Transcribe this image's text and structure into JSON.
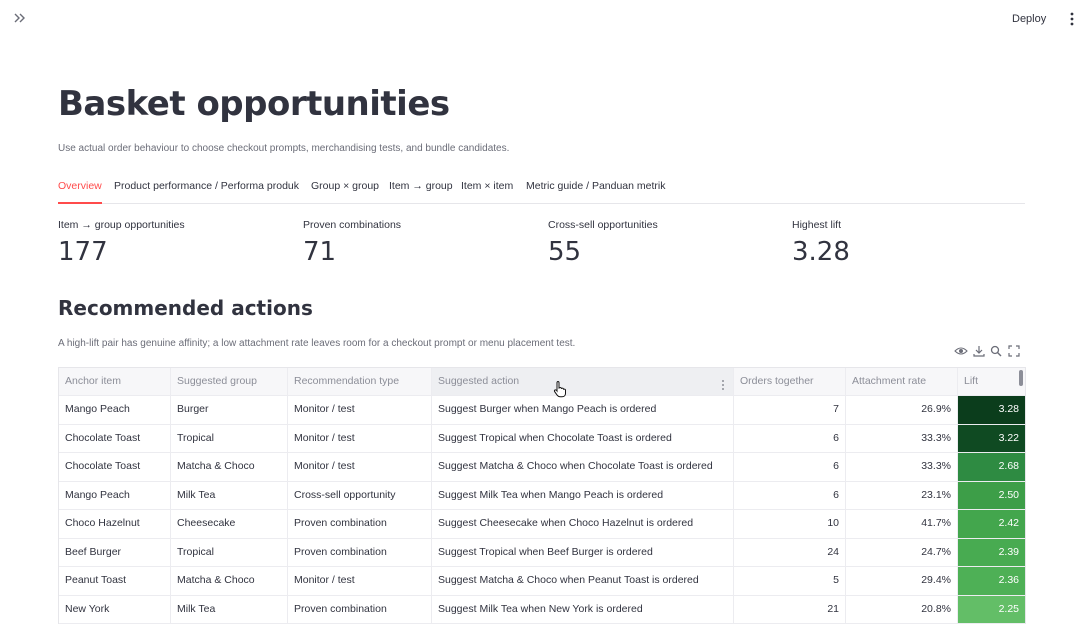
{
  "topbar": {
    "deploy_label": "Deploy",
    "expand_icon": "double-chevron-right-icon",
    "menu_icon": "kebab-menu-icon"
  },
  "page": {
    "title": "Basket opportunities",
    "caption": "Use actual order behaviour to choose checkout prompts, merchandising tests, and bundle candidates."
  },
  "tabs": [
    {
      "label": "Overview",
      "active": true
    },
    {
      "label": "Product performance / Performa produk",
      "active": false
    },
    {
      "label": "Group × group",
      "active": false
    },
    {
      "label": "Item → group",
      "active": false
    },
    {
      "label": "Item × item",
      "active": false
    },
    {
      "label": "Metric guide / Panduan metrik",
      "active": false
    }
  ],
  "metrics": [
    {
      "label": "Item → group opportunities",
      "value": "177"
    },
    {
      "label": "Proven combinations",
      "value": "71"
    },
    {
      "label": "Cross-sell opportunities",
      "value": "55"
    },
    {
      "label": "Highest lift",
      "value": "3.28"
    }
  ],
  "section": {
    "title": "Recommended actions",
    "caption": "A high-lift pair has genuine affinity; a low attachment rate leaves room for a checkout prompt or menu placement test."
  },
  "table_toolbar_icons": [
    "eye-icon",
    "download-icon",
    "search-icon",
    "fullscreen-icon"
  ],
  "table": {
    "columns": [
      "Anchor item",
      "Suggested group",
      "Recommendation type",
      "Suggested action",
      "Orders together",
      "Attachment rate",
      "Lift"
    ],
    "rows": [
      [
        "Mango Peach",
        "Burger",
        "Monitor / test",
        "Suggest Burger when Mango Peach is ordered",
        "7",
        "26.9%",
        "3.28"
      ],
      [
        "Chocolate Toast",
        "Tropical",
        "Monitor / test",
        "Suggest Tropical when Chocolate Toast is ordered",
        "6",
        "33.3%",
        "3.22"
      ],
      [
        "Chocolate Toast",
        "Matcha & Choco",
        "Monitor / test",
        "Suggest Matcha & Choco when Chocolate Toast is ordered",
        "6",
        "33.3%",
        "2.68"
      ],
      [
        "Mango Peach",
        "Milk Tea",
        "Cross-sell opportunity",
        "Suggest Milk Tea when Mango Peach is ordered",
        "6",
        "23.1%",
        "2.50"
      ],
      [
        "Choco Hazelnut",
        "Cheesecake",
        "Proven combination",
        "Suggest Cheesecake when Choco Hazelnut is ordered",
        "10",
        "41.7%",
        "2.42"
      ],
      [
        "Beef Burger",
        "Tropical",
        "Proven combination",
        "Suggest Tropical when Beef Burger is ordered",
        "24",
        "24.7%",
        "2.39"
      ],
      [
        "Peanut Toast",
        "Matcha & Choco",
        "Monitor / test",
        "Suggest Matcha & Choco when Peanut Toast is ordered",
        "5",
        "29.4%",
        "2.36"
      ],
      [
        "New York",
        "Milk Tea",
        "Proven combination",
        "Suggest Milk Tea when New York is ordered",
        "21",
        "20.8%",
        "2.25"
      ]
    ],
    "lift_colors": [
      "#0b3d1c",
      "#0f4a22",
      "#2e8b42",
      "#3d9e48",
      "#43a64d",
      "#48ab51",
      "#4eb056",
      "#63be67"
    ]
  },
  "colors": {
    "accent": "#ff4b4b",
    "text": "#31333f",
    "muted": "#6b6d78"
  }
}
